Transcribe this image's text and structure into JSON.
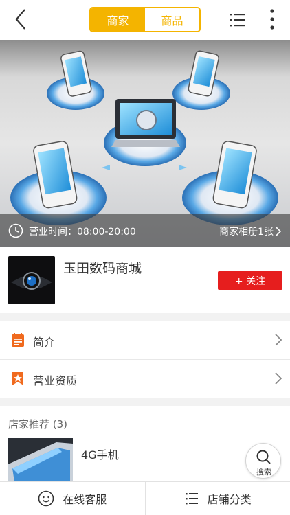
{
  "header": {
    "tabs": [
      {
        "label": "商家",
        "active": true
      },
      {
        "label": "商品",
        "active": false
      }
    ],
    "icons": [
      "back-arrow-icon",
      "list-menu-icon",
      "more-vertical-icon"
    ]
  },
  "banner": {
    "hours_label": "营业时间：08:00-20:00",
    "album_label": "商家相册1张",
    "image": "phones-connected-to-laptop-illustration"
  },
  "shop": {
    "name": "玉田数码商城",
    "follow_label": "+ 关注"
  },
  "info": {
    "items": [
      {
        "label": "简介",
        "icon": "document-icon"
      },
      {
        "label": "营业资质",
        "icon": "badge-star-icon"
      }
    ]
  },
  "recommend": {
    "title": "店家推荐 (3)",
    "product_name": "4G手机"
  },
  "search_fab": {
    "label": "搜索"
  },
  "bottom_bar": {
    "items": [
      {
        "label": "在线客服",
        "icon": "smiley-icon"
      },
      {
        "label": "店铺分类",
        "icon": "list-icon"
      }
    ]
  },
  "colors": {
    "accent": "#f4b400",
    "follow": "#e61e1e",
    "icon_orange": "#f06a1e"
  }
}
